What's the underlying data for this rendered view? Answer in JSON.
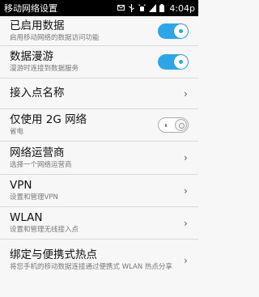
{
  "statusbar": {
    "title": "移动网络设置",
    "time": "4:04p"
  },
  "settings": [
    {
      "title": "已启用数据",
      "subtitle": "启用移动网络的数据访问功能",
      "control": "toggle-on"
    },
    {
      "title": "数据漫游",
      "subtitle": "漫游时连接到数据服务",
      "control": "toggle-on"
    },
    {
      "title": "接入点名称",
      "subtitle": "",
      "control": "chevron"
    },
    {
      "title": "仅使用 2G 网络",
      "subtitle": "省电",
      "control": "toggle-off"
    },
    {
      "title": "网络运营商",
      "subtitle": "选择一个网络运营商",
      "control": "chevron"
    },
    {
      "title": "VPN",
      "subtitle": "设置和管理VPN",
      "control": "chevron"
    },
    {
      "title": "WLAN",
      "subtitle": "设置和管理无线接入点",
      "control": "chevron"
    },
    {
      "title": "绑定与便携式热点",
      "subtitle": "将您手机的移动数据连接通过便携式 WLAN 热点分享",
      "control": "chevron"
    }
  ],
  "icons": {
    "toggle_on_color": "#2aa7e8"
  }
}
